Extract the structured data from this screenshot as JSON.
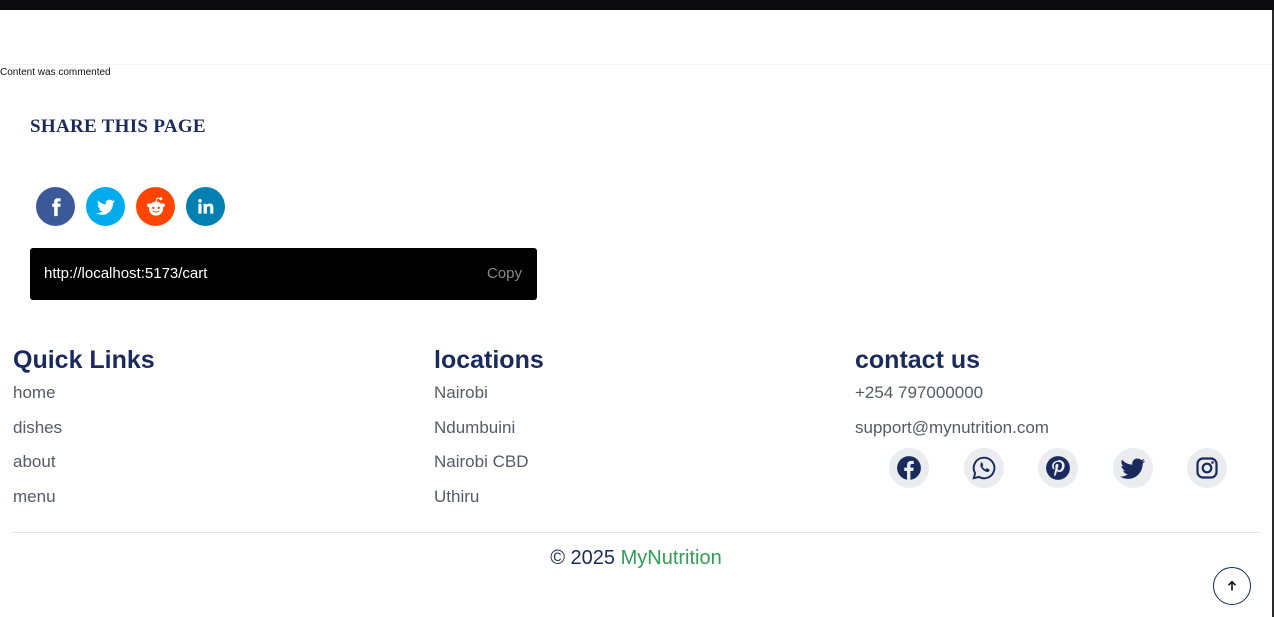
{
  "comment_note": "Content was commented",
  "share": {
    "title": "SHARE THIS PAGE",
    "icons": [
      {
        "name": "facebook-icon",
        "color": "#3b5998"
      },
      {
        "name": "twitter-icon",
        "color": "#00aced"
      },
      {
        "name": "reddit-icon",
        "color": "#ff4500"
      },
      {
        "name": "linkedin-icon",
        "color": "#007fb1"
      }
    ],
    "url": "http://localhost:5173/cart",
    "copy_label": "Copy"
  },
  "footer": {
    "quick_links": {
      "title": "Quick Links",
      "items": [
        "home",
        "dishes",
        "about",
        "menu"
      ]
    },
    "locations": {
      "title": "locations",
      "items": [
        "Nairobi",
        "Ndumbuini",
        "Nairobi CBD",
        "Uthiru"
      ]
    },
    "contact": {
      "title": "contact us",
      "phone": "+254 797000000",
      "email": "support@mynutrition.com",
      "social": [
        "facebook-icon",
        "whatsapp-icon",
        "pinterest-icon",
        "twitter-icon",
        "instagram-icon"
      ]
    },
    "copyright_prefix": "© 2025 ",
    "brand": "MyNutrition",
    "brand_color": "#2e9e58",
    "text_color": "#1b2a5c"
  },
  "scroll_top": {
    "icon": "arrow-up-icon"
  }
}
